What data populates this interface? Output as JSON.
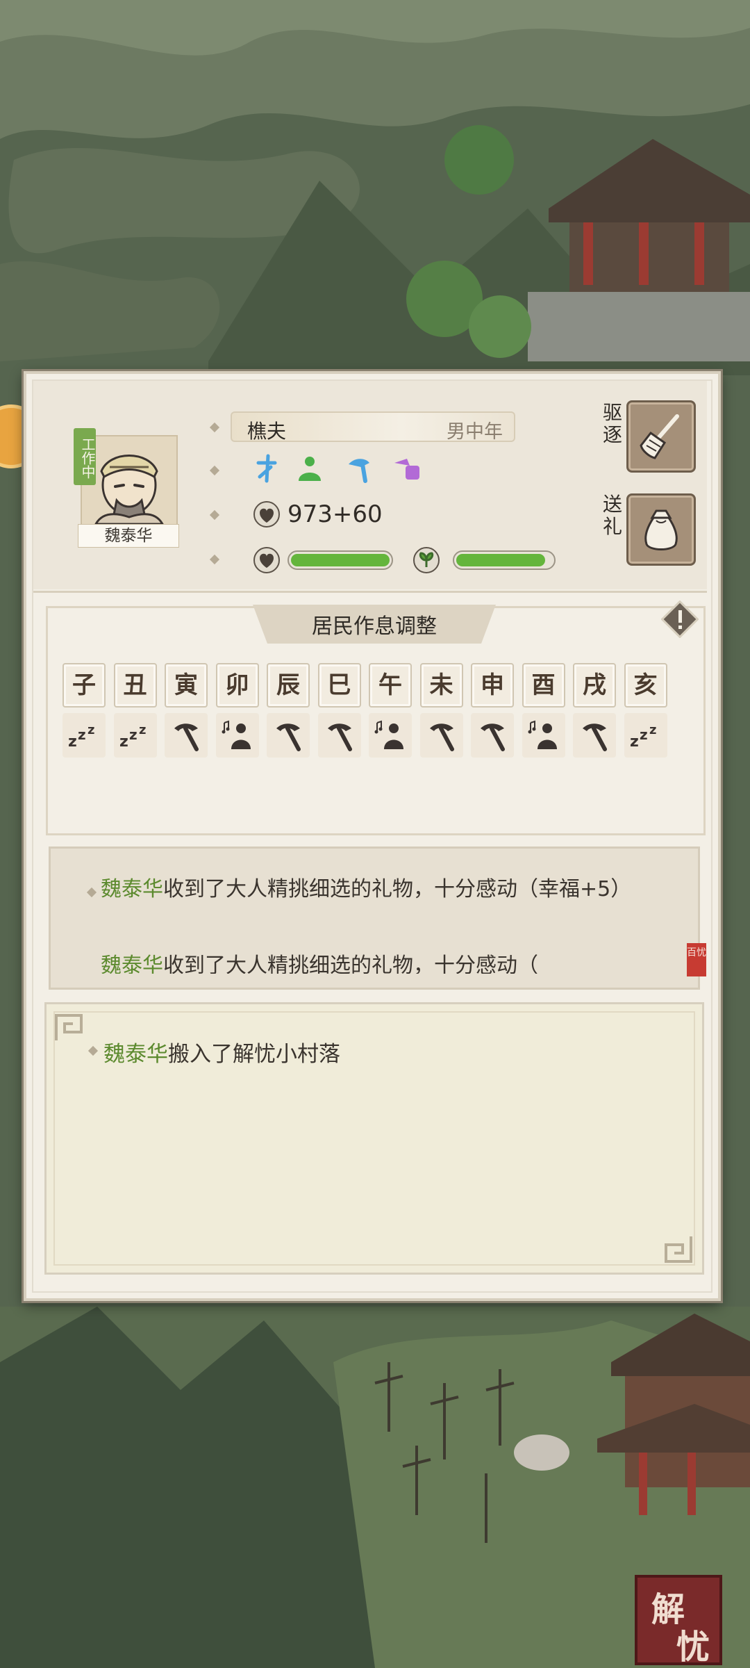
{
  "resident": {
    "name": "魏泰华",
    "status_badge": "工作中",
    "job": "樵夫",
    "gender_age": "男中年",
    "money": "973+60",
    "skills": [
      "blue-talent-icon",
      "green-incense-icon",
      "blue-axe-icon",
      "purple-pot-icon"
    ],
    "health_fraction": 1.0,
    "mood_fraction": 0.93
  },
  "actions": {
    "expel_label": "驱逐",
    "gift_label": "送礼"
  },
  "schedule": {
    "title": "居民作息调整",
    "hours": [
      "子",
      "丑",
      "寅",
      "卯",
      "辰",
      "巳",
      "午",
      "未",
      "申",
      "酉",
      "戌",
      "亥"
    ],
    "activities": [
      "sleep",
      "sleep",
      "work",
      "leisure",
      "work",
      "work",
      "leisure",
      "work",
      "work",
      "leisure",
      "work",
      "sleep"
    ]
  },
  "log1": {
    "line1_name": "魏泰华",
    "line1_text": "收到了大人精挑细选的礼物，十分感动（幸福+5）",
    "line2_name": "魏泰华",
    "line2_text": "收到了大人精挑细选的礼物，十分感动（",
    "seal_text": "百忧"
  },
  "log2": {
    "line1_name": "魏泰华",
    "line1_text": "搬入了解忧小村落"
  },
  "brand": {
    "char1": "解",
    "char2": "忧"
  },
  "colors": {
    "accent_green": "#64b53c",
    "name_green": "#5c8a2e",
    "panel_bg": "#f3efe6"
  }
}
